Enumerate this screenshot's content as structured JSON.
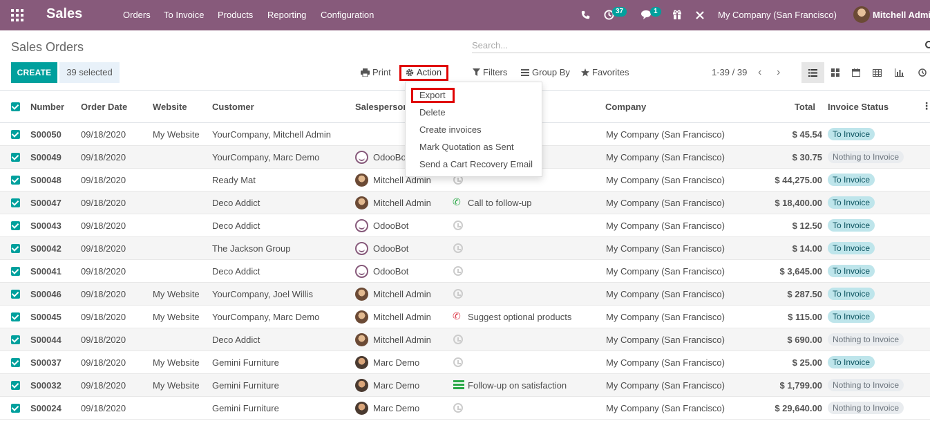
{
  "navbar": {
    "app_title": "Sales",
    "menu": [
      "Orders",
      "To Invoice",
      "Products",
      "Reporting",
      "Configuration"
    ],
    "activity_count": "37",
    "message_count": "1",
    "company": "My Company (San Francisco)",
    "user": "Mitchell Admin",
    "color": "#875a7b"
  },
  "control_panel": {
    "breadcrumb": "Sales Orders",
    "search_placeholder": "Search...",
    "create_label": "CREATE",
    "selected_label": "39 selected",
    "print_label": "Print",
    "action_label": "Action",
    "filters_label": "Filters",
    "group_by_label": "Group By",
    "favorites_label": "Favorites",
    "pager": "1-39 / 39"
  },
  "action_menu": [
    "Export",
    "Delete",
    "Create invoices",
    "Mark Quotation as Sent",
    "Send a Cart Recovery Email"
  ],
  "columns": [
    "Number",
    "Order Date",
    "Website",
    "Customer",
    "Salesperson",
    "Company",
    "Total",
    "Invoice Status"
  ],
  "rows": [
    {
      "number": "S00050",
      "date": "09/18/2020",
      "website": "My Website",
      "customer": "YourCompany, Mitchell Admin",
      "salesperson": "",
      "avatar": "none",
      "activity": "",
      "activity_icon": "none",
      "company": "My Company (San Francisco)",
      "total": "$ 45.54",
      "status": "To Invoice"
    },
    {
      "number": "S00049",
      "date": "09/18/2020",
      "website": "",
      "customer": "YourCompany, Marc Demo",
      "salesperson": "OdooBot",
      "avatar": "bot",
      "activity": "",
      "activity_icon": "none",
      "company": "My Company (San Francisco)",
      "total": "$ 30.75",
      "status": "Nothing to Invoice"
    },
    {
      "number": "S00048",
      "date": "09/18/2020",
      "website": "",
      "customer": "Ready Mat",
      "salesperson": "Mitchell Admin",
      "avatar": "mitchell",
      "activity": "",
      "activity_icon": "clock",
      "company": "My Company (San Francisco)",
      "total": "$ 44,275.00",
      "status": "To Invoice"
    },
    {
      "number": "S00047",
      "date": "09/18/2020",
      "website": "",
      "customer": "Deco Addict",
      "salesperson": "Mitchell Admin",
      "avatar": "mitchell",
      "activity": "Call to follow-up",
      "activity_icon": "phone-green",
      "company": "My Company (San Francisco)",
      "total": "$ 18,400.00",
      "status": "To Invoice"
    },
    {
      "number": "S00043",
      "date": "09/18/2020",
      "website": "",
      "customer": "Deco Addict",
      "salesperson": "OdooBot",
      "avatar": "bot",
      "activity": "",
      "activity_icon": "clock",
      "company": "My Company (San Francisco)",
      "total": "$ 12.50",
      "status": "To Invoice"
    },
    {
      "number": "S00042",
      "date": "09/18/2020",
      "website": "",
      "customer": "The Jackson Group",
      "salesperson": "OdooBot",
      "avatar": "bot",
      "activity": "",
      "activity_icon": "clock",
      "company": "My Company (San Francisco)",
      "total": "$ 14.00",
      "status": "To Invoice"
    },
    {
      "number": "S00041",
      "date": "09/18/2020",
      "website": "",
      "customer": "Deco Addict",
      "salesperson": "OdooBot",
      "avatar": "bot",
      "activity": "",
      "activity_icon": "clock",
      "company": "My Company (San Francisco)",
      "total": "$ 3,645.00",
      "status": "To Invoice"
    },
    {
      "number": "S00046",
      "date": "09/18/2020",
      "website": "My Website",
      "customer": "YourCompany, Joel Willis",
      "salesperson": "Mitchell Admin",
      "avatar": "mitchell",
      "activity": "",
      "activity_icon": "clock",
      "company": "My Company (San Francisco)",
      "total": "$ 287.50",
      "status": "To Invoice"
    },
    {
      "number": "S00045",
      "date": "09/18/2020",
      "website": "My Website",
      "customer": "YourCompany, Marc Demo",
      "salesperson": "Mitchell Admin",
      "avatar": "mitchell",
      "activity": "Suggest optional products",
      "activity_icon": "phone-red",
      "company": "My Company (San Francisco)",
      "total": "$ 115.00",
      "status": "To Invoice"
    },
    {
      "number": "S00044",
      "date": "09/18/2020",
      "website": "",
      "customer": "Deco Addict",
      "salesperson": "Mitchell Admin",
      "avatar": "mitchell",
      "activity": "",
      "activity_icon": "clock",
      "company": "My Company (San Francisco)",
      "total": "$ 690.00",
      "status": "Nothing to Invoice"
    },
    {
      "number": "S00037",
      "date": "09/18/2020",
      "website": "My Website",
      "customer": "Gemini Furniture",
      "salesperson": "Marc Demo",
      "avatar": "marc",
      "activity": "",
      "activity_icon": "clock",
      "company": "My Company (San Francisco)",
      "total": "$ 25.00",
      "status": "To Invoice"
    },
    {
      "number": "S00032",
      "date": "09/18/2020",
      "website": "My Website",
      "customer": "Gemini Furniture",
      "salesperson": "Marc Demo",
      "avatar": "marc",
      "activity": "Follow-up on satisfaction",
      "activity_icon": "list-green",
      "company": "My Company (San Francisco)",
      "total": "$ 1,799.00",
      "status": "Nothing to Invoice"
    },
    {
      "number": "S00024",
      "date": "09/18/2020",
      "website": "",
      "customer": "Gemini Furniture",
      "salesperson": "Marc Demo",
      "avatar": "marc",
      "activity": "",
      "activity_icon": "clock",
      "company": "My Company (San Francisco)",
      "total": "$ 29,640.00",
      "status": "Nothing to Invoice"
    }
  ]
}
